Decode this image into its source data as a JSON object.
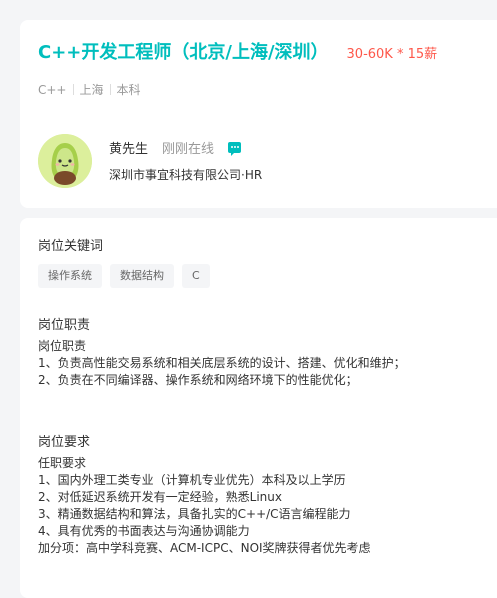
{
  "job": {
    "title": "C++开发工程师（北京/上海/深圳）",
    "salary": "30-60K * 15薪",
    "tags": [
      "C++",
      "上海",
      "本科"
    ]
  },
  "recruiter": {
    "name": "黄先生",
    "status": "刚刚在线",
    "company_role": "深圳市事宜科技有限公司·HR",
    "avatar_icon": "avocado-avatar",
    "chat_icon": "chat-bubble-icon"
  },
  "keywords": {
    "heading": "岗位关键词",
    "tags": [
      "操作系统",
      "数据结构",
      "C"
    ]
  },
  "responsibilities": {
    "heading": "岗位职责",
    "lines": [
      "岗位职责",
      "1、负责高性能交易系统和相关底层系统的设计、搭建、优化和维护；",
      "2、负责在不同编译器、操作系统和网络环境下的性能优化；"
    ]
  },
  "requirements": {
    "heading": "岗位要求",
    "lines": [
      "任职要求",
      "1、国内外理工类专业（计算机专业优先）本科及以上学历",
      "2、对低延迟系统开发有一定经验，熟悉Linux",
      "3、精通数据结构和算法，具备扎实的C++/C语言编程能力",
      "4、具有优秀的书面表达与沟通协调能力",
      "加分项：高中学科竞赛、ACM-ICPC、NOI奖牌获得者优先考虑"
    ]
  },
  "colors": {
    "accent": "#00bebd",
    "salary": "#fe574a",
    "background": "#f4f5f7"
  }
}
